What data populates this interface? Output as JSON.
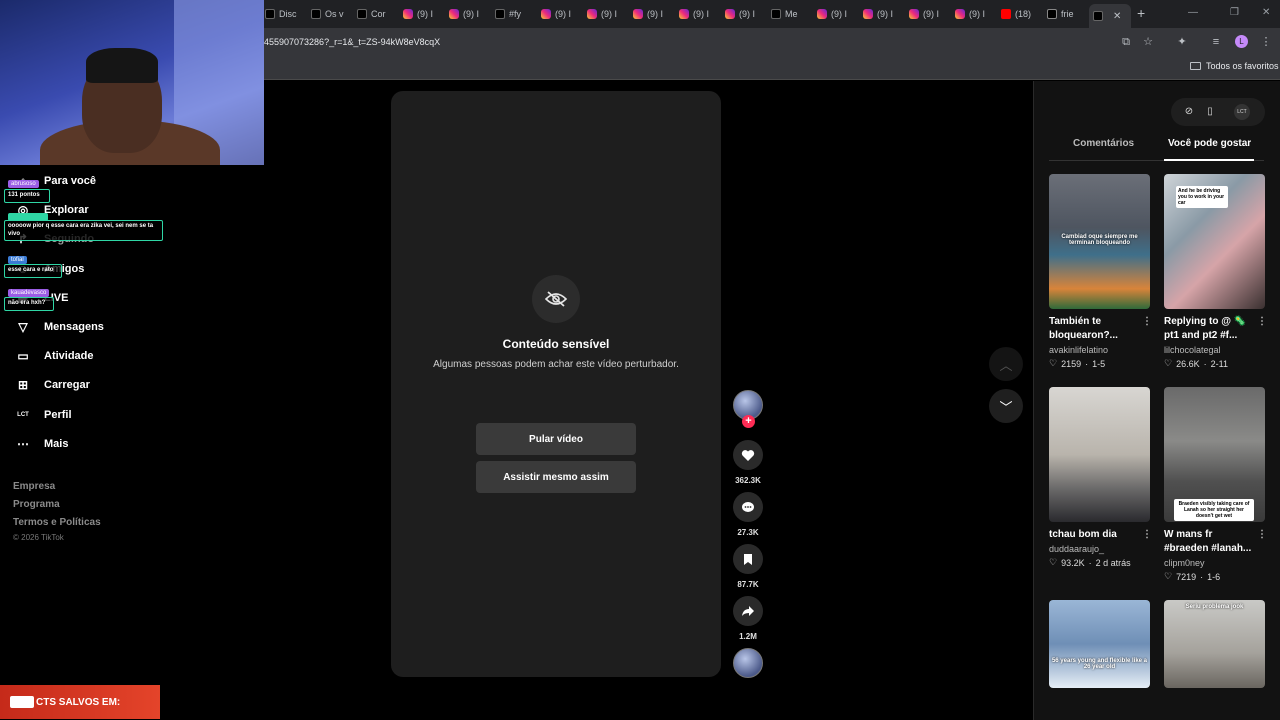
{
  "browser": {
    "tabs": [
      {
        "label": "Disc",
        "icon": "tiktok-icon"
      },
      {
        "label": "Os v",
        "icon": "tiktok-icon"
      },
      {
        "label": "Cor",
        "icon": "tiktok-icon"
      },
      {
        "label": "(9) I",
        "icon": "instagram-icon"
      },
      {
        "label": "(9) I",
        "icon": "instagram-icon"
      },
      {
        "label": "#fy",
        "icon": "tiktok-icon"
      },
      {
        "label": "(9) I",
        "icon": "instagram-icon"
      },
      {
        "label": "(9) I",
        "icon": "instagram-icon"
      },
      {
        "label": "(9) I",
        "icon": "instagram-icon"
      },
      {
        "label": "(9) I",
        "icon": "instagram-icon"
      },
      {
        "label": "(9) I",
        "icon": "instagram-icon"
      },
      {
        "label": "Me",
        "icon": "tiktok-icon"
      },
      {
        "label": "(9) I",
        "icon": "instagram-icon"
      },
      {
        "label": "(9) I",
        "icon": "instagram-icon"
      },
      {
        "label": "(9) I",
        "icon": "instagram-icon"
      },
      {
        "label": "(9) I",
        "icon": "instagram-icon"
      },
      {
        "label": "(18)",
        "icon": "youtube-icon"
      },
      {
        "label": "frie",
        "icon": "x-icon"
      }
    ],
    "url": "455907073286?_r=1&_t=ZS-94kW8eV8cqX",
    "bookmarks_folder": "Todos os favoritos",
    "profile_initial": "L"
  },
  "sidebar": {
    "items": [
      {
        "label": "Para você",
        "icon": "home-icon"
      },
      {
        "label": "Explorar",
        "icon": "compass-icon"
      },
      {
        "label": "Seguindo",
        "icon": "following-icon"
      },
      {
        "label": "Amigos",
        "icon": "friends-icon"
      },
      {
        "label": "LIVE",
        "icon": "live-icon"
      },
      {
        "label": "Mensagens",
        "icon": "message-icon"
      },
      {
        "label": "Atividade",
        "icon": "activity-icon"
      },
      {
        "label": "Carregar",
        "icon": "upload-icon"
      },
      {
        "label": "Perfil",
        "icon": "profile-icon"
      },
      {
        "label": "Mais",
        "icon": "more-icon"
      }
    ],
    "footer": [
      "Empresa",
      "Programa",
      "Termos e Políticas"
    ],
    "copyright": "© 2026 TikTok"
  },
  "chat": {
    "user1": "abrusoso",
    "points": "131 pontos",
    "msg1": "ooooow pior q esse cara era zika vei, sei nem se ta vivo",
    "user2": "tofial",
    "msg2": "esse cara e rato",
    "user3": "kauadevasco",
    "msg3": "não era hxh?"
  },
  "banner": {
    "text": "CTS SALVOS EM:"
  },
  "video": {
    "title": "Conteúdo sensível",
    "subtitle": "Algumas pessoas podem achar este vídeo perturbador.",
    "skip_button": "Pular vídeo",
    "watch_button": "Assistir mesmo assim"
  },
  "actions": {
    "likes": "362.3K",
    "comments": "27.3K",
    "saves": "87.7K",
    "shares": "1.2M"
  },
  "right_panel": {
    "tabs": [
      "Comentários",
      "Você pode gostar"
    ],
    "active_tab": 1,
    "cards": [
      {
        "title": "También te bloquearon?...",
        "author": "avakinlifelatino",
        "likes": "2159",
        "date": "1-5",
        "overlay": "Cambiad  oque siempre me terminan bloqueando"
      },
      {
        "title": "Replying to @ 🦠pt1 and pt2 #f...",
        "author": "lilchocolategal",
        "likes": "26.6K",
        "date": "2-11",
        "overlay": "And he be driving you to work in your car"
      },
      {
        "title": "tchau bom dia",
        "author": "duddaaraujo_",
        "likes": "93.2K",
        "date": "2 d atrás",
        "overlay": ""
      },
      {
        "title": "W mans fr #braeden #lanah...",
        "author": "clipm0ney",
        "likes": "7219",
        "date": "1-6",
        "overlay": "Braeden visibly taking care of Lanah so her straight her doesn't get wet"
      },
      {
        "title": "",
        "author": "",
        "likes": "",
        "date": "",
        "overlay": "56 years young and flexible like a 26 year old"
      },
      {
        "title": "",
        "author": "",
        "likes": "",
        "date": "",
        "overlay": "Seriu  problema jook"
      }
    ]
  }
}
